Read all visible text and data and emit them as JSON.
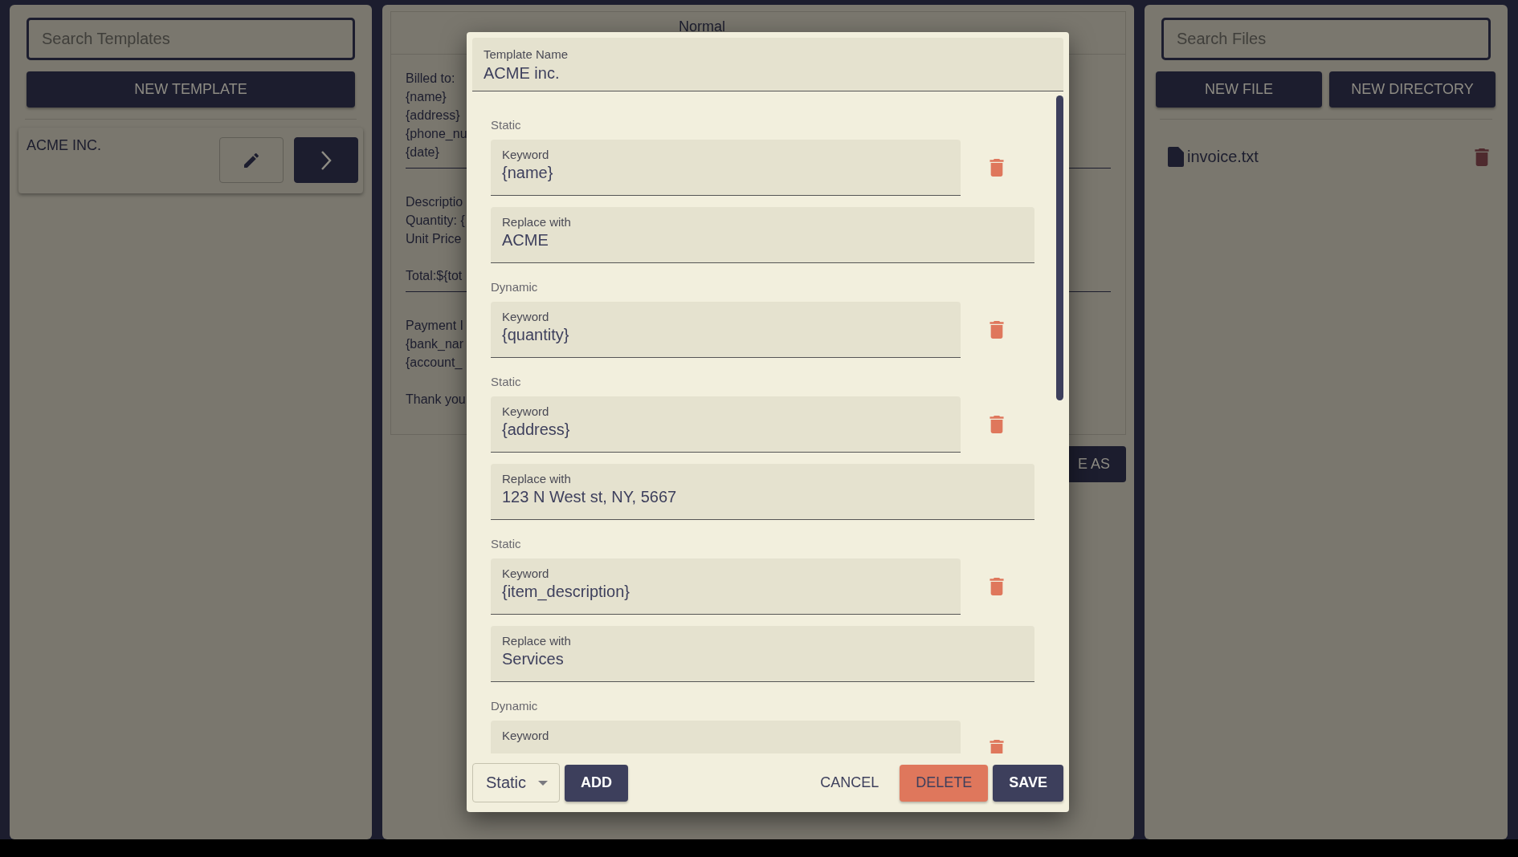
{
  "templates_panel": {
    "search": {
      "placeholder": "Search Templates"
    },
    "new_button": "NEW TEMPLATE",
    "templates": [
      {
        "name": "ACME INC."
      }
    ]
  },
  "editor": {
    "toolbar": {
      "format": "Normal"
    },
    "sections": [
      {
        "paragraphs": [
          [
            "Billed to:",
            "{name}",
            "{address}",
            "{phone_nu",
            "{date}"
          ]
        ]
      },
      {
        "paragraphs": [
          [
            "Descriptio",
            "Quantity: {",
            "Unit Price"
          ],
          [
            "Total:${tot"
          ]
        ]
      },
      {
        "paragraphs": [
          [
            "Payment I",
            "{bank_nar",
            "{account_"
          ],
          [
            "Thank you"
          ]
        ]
      }
    ],
    "save_as": "E AS"
  },
  "files_panel": {
    "search": {
      "placeholder": "Search Files"
    },
    "buttons": [
      "NEW FILE",
      "NEW DIRECTORY"
    ],
    "files": [
      {
        "name": "invoice.txt"
      }
    ]
  },
  "dialog": {
    "name_label": "Template Name",
    "name_value": "ACME inc.",
    "rules": [
      {
        "kind": "static",
        "type_label": "Static",
        "keyword_label": "Keyword",
        "keyword": "{name}",
        "replace_label": "Replace with",
        "replace": "ACME"
      },
      {
        "kind": "dynamic",
        "type_label": "Dynamic",
        "keyword_label": "Keyword",
        "keyword": "{quantity}"
      },
      {
        "kind": "static",
        "type_label": "Static",
        "keyword_label": "Keyword",
        "keyword": "{address}",
        "replace_label": "Replace with",
        "replace": "123 N West st, NY, 5667"
      },
      {
        "kind": "static",
        "type_label": "Static",
        "keyword_label": "Keyword",
        "keyword": "{item_description}",
        "replace_label": "Replace with",
        "replace": "Services"
      },
      {
        "kind": "dynamic",
        "type_label": "Dynamic",
        "keyword_label": "Keyword"
      }
    ],
    "type_select": "Static",
    "add": "ADD",
    "cancel": "CANCEL",
    "delete": "DELETE",
    "save": "SAVE"
  }
}
